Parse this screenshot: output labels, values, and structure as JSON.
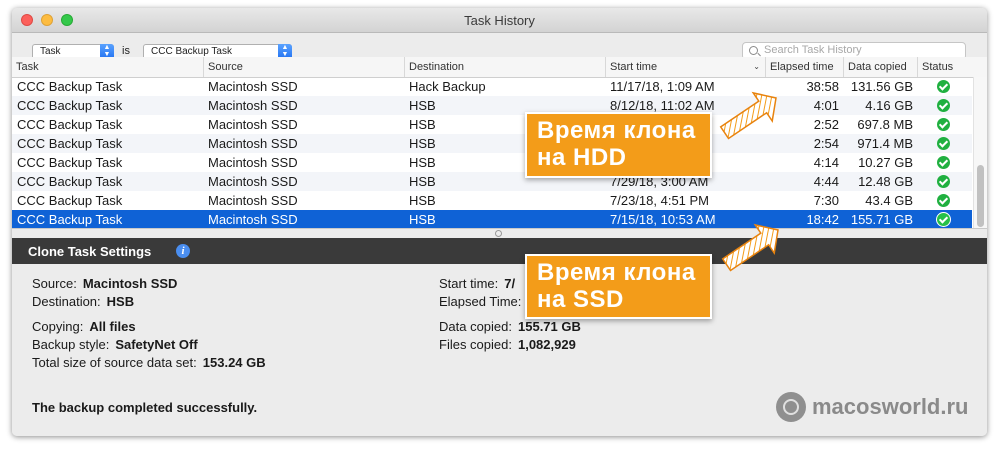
{
  "window": {
    "title": "Task History"
  },
  "filter": {
    "field_popup": "Task",
    "operator": "is",
    "value_popup": "CCC Backup Task",
    "search_placeholder": "Search Task History"
  },
  "table": {
    "columns": [
      "Task",
      "Source",
      "Destination",
      "Start time",
      "Elapsed time",
      "Data copied",
      "Status"
    ],
    "rows": [
      {
        "task": "CCC Backup Task",
        "source": "Macintosh SSD",
        "destination": "Hack Backup",
        "start": "11/17/18, 1:09 AM",
        "elapsed": "38:58",
        "copied": "131.56 GB",
        "status": "success"
      },
      {
        "task": "CCC Backup Task",
        "source": "Macintosh SSD",
        "destination": "HSB",
        "start": "8/12/18, 11:02 AM",
        "elapsed": "4:01",
        "copied": "4.16 GB",
        "status": "success"
      },
      {
        "task": "CCC Backup Task",
        "source": "Macintosh SSD",
        "destination": "HSB",
        "start": "",
        "elapsed": "2:52",
        "copied": "697.8 MB",
        "status": "success"
      },
      {
        "task": "CCC Backup Task",
        "source": "Macintosh SSD",
        "destination": "HSB",
        "start": "",
        "elapsed": "2:54",
        "copied": "971.4 MB",
        "status": "success"
      },
      {
        "task": "CCC Backup Task",
        "source": "Macintosh SSD",
        "destination": "HSB",
        "start": "",
        "elapsed": "4:14",
        "copied": "10.27 GB",
        "status": "success"
      },
      {
        "task": "CCC Backup Task",
        "source": "Macintosh SSD",
        "destination": "HSB",
        "start": "7/29/18, 3:00 AM",
        "elapsed": "4:44",
        "copied": "12.48 GB",
        "status": "success"
      },
      {
        "task": "CCC Backup Task",
        "source": "Macintosh SSD",
        "destination": "HSB",
        "start": "7/23/18, 4:51 PM",
        "elapsed": "7:30",
        "copied": "43.4 GB",
        "status": "success"
      },
      {
        "task": "CCC Backup Task",
        "source": "Macintosh SSD",
        "destination": "HSB",
        "start": "7/15/18, 10:53 AM",
        "elapsed": "18:42",
        "copied": "155.71 GB",
        "status": "success"
      }
    ]
  },
  "settings": {
    "header": "Clone Task Settings",
    "source_label": "Source:",
    "source_value": "Macintosh SSD",
    "destination_label": "Destination:",
    "destination_value": "HSB",
    "copying_label": "Copying:",
    "copying_value": "All files",
    "backup_style_label": "Backup style:",
    "backup_style_value": "SafetyNet Off",
    "total_size_label": "Total size of source data set:",
    "total_size_value": "153.24 GB",
    "start_time_label": "Start time:",
    "start_time_value": "7/",
    "elapsed_label": "Elapsed Time:",
    "data_copied_label": "Data copied:",
    "data_copied_value": "155.71 GB",
    "files_copied_label": "Files copied:",
    "files_copied_value": "1,082,929",
    "status_message": "The backup completed successfully."
  },
  "annotations": {
    "hdd_line1": "Время клона",
    "hdd_line2": "на HDD",
    "ssd_line1": "Время клона",
    "ssd_line2": "на SSD",
    "color": "#f39c19"
  },
  "watermark": {
    "text": "macosworld.ru"
  }
}
